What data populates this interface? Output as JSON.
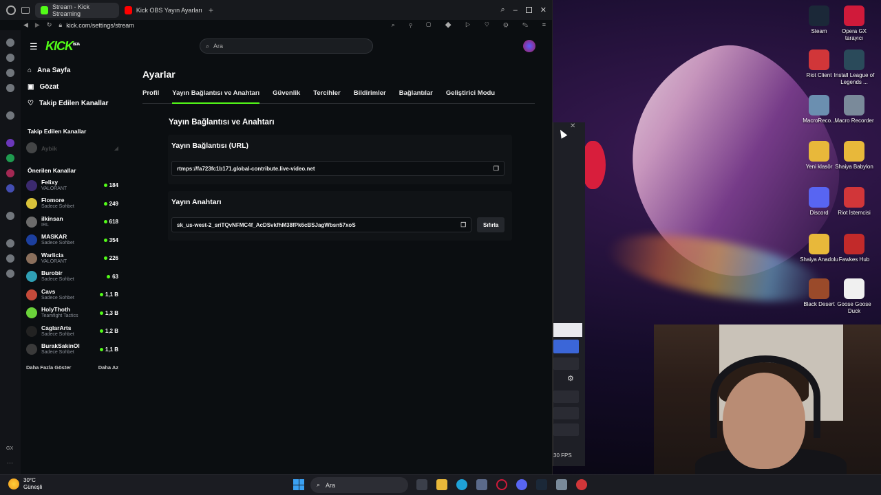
{
  "browser": {
    "tabs": [
      {
        "label": "Stream - Kick Streaming",
        "active": true
      },
      {
        "label": "Kick OBS Yayın Ayarları N",
        "active": false
      }
    ],
    "url": "kick.com/settings/stream"
  },
  "kick": {
    "logo": "KICK",
    "logo_badge": "BETA",
    "search_placeholder": "Ara",
    "nav": [
      {
        "label": "Ana Sayfa",
        "icon": "home-icon"
      },
      {
        "label": "Gözat",
        "icon": "browse-icon"
      },
      {
        "label": "Takip Edilen Kanallar",
        "icon": "heart-icon"
      }
    ],
    "followed_title": "Takip Edilen Kanallar",
    "followed": [
      {
        "name": "Aybik"
      }
    ],
    "recommended_title": "Önerilen Kanallar",
    "recommended": [
      {
        "name": "Felixy",
        "category": "VALORANT",
        "viewers": "184",
        "color": "#3b2a6e"
      },
      {
        "name": "Flomore",
        "category": "Sadece Sohbet",
        "viewers": "249",
        "color": "#d8c23a"
      },
      {
        "name": "ilkinsan",
        "category": "IRL",
        "viewers": "618",
        "color": "#6b6b6b"
      },
      {
        "name": "MASKAR",
        "category": "Sadece Sohbet",
        "viewers": "354",
        "color": "#1c3f9e"
      },
      {
        "name": "Warlicia",
        "category": "VALORANT",
        "viewers": "226",
        "color": "#8a6f5c"
      },
      {
        "name": "Burobir",
        "category": "Sadece Sohbet",
        "viewers": "63",
        "color": "#2f9fb4"
      },
      {
        "name": "Cavs",
        "category": "Sadece Sohbet",
        "viewers": "1,1 B",
        "color": "#c44a3a"
      },
      {
        "name": "HolyThoth",
        "category": "Teamfight Tactics",
        "viewers": "1,3 B",
        "color": "#6bd23a"
      },
      {
        "name": "CaglarArts",
        "category": "Sadece Sohbet",
        "viewers": "1,2 B",
        "color": "#222222"
      },
      {
        "name": "BurakSakinOl",
        "category": "Sadece Sohbet",
        "viewers": "1,1 B",
        "color": "#3a3a3a"
      }
    ],
    "show_more": "Daha Fazla Göster",
    "show_less": "Daha Az"
  },
  "settings": {
    "title": "Ayarlar",
    "tabs": [
      "Profil",
      "Yayın Bağlantısı ve Anahtarı",
      "Güvenlik",
      "Tercihler",
      "Bildirimler",
      "Bağlantılar",
      "Geliştirici Modu"
    ],
    "active_tab": "Yayın Bağlantısı ve Anahtarı",
    "section_title": "Yayın Bağlantısı ve Anahtarı",
    "url_card": {
      "title": "Yayın Bağlantısı (URL)",
      "value": "rtmps://fa723fc1b171.global-contribute.live-video.net"
    },
    "key_card": {
      "title": "Yayın Anahtarı",
      "value": "sk_us-west-2_sriTQvNFMC4f_AcDSvkfhM38fPk6cBSJagWbsn57xoS",
      "reset_label": "Sıfırla"
    }
  },
  "obs": {
    "fps": "30 FPS"
  },
  "desktop_icons": [
    {
      "label": "Steam",
      "color": "#1b2838"
    },
    {
      "label": "Opera GX tarayıcı",
      "color": "#d01a3a"
    },
    {
      "label": "Riot Client",
      "color": "#d13639"
    },
    {
      "label": "Install League of Legends ...",
      "color": "#2a4a5a"
    },
    {
      "label": "MacroReco...",
      "color": "#6b8fb0"
    },
    {
      "label": "Macro Recorder",
      "color": "#7a8a9a"
    },
    {
      "label": "Yeni klasör",
      "color": "#e8b83a"
    },
    {
      "label": "Shaiya Babylon",
      "color": "#e8b83a"
    },
    {
      "label": "Discord",
      "color": "#5865f2"
    },
    {
      "label": "Riot İstemcisi",
      "color": "#d13639"
    },
    {
      "label": "Shaiya Anadolu",
      "color": "#e8b83a"
    },
    {
      "label": "Fawkes Hub",
      "color": "#c22a2a"
    },
    {
      "label": "Black Desert",
      "color": "#9a4a2a"
    },
    {
      "label": "Goose Goose Duck",
      "color": "#f0f0f0"
    }
  ],
  "taskbar": {
    "temperature": "30°C",
    "weather": "Güneşli",
    "search": "Ara"
  }
}
